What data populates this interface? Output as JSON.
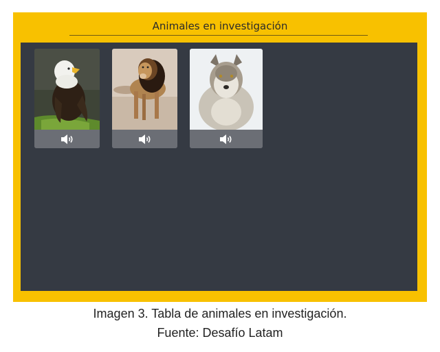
{
  "panel": {
    "title": "Animales en investigación"
  },
  "animals": [
    {
      "name": "eagle",
      "icon": "speaker-icon"
    },
    {
      "name": "lion",
      "icon": "speaker-icon"
    },
    {
      "name": "wolf",
      "icon": "speaker-icon"
    }
  ],
  "caption": {
    "line1": "Imagen 3. Tabla de animales en investigación.",
    "line2": "Fuente: Desafío Latam"
  },
  "colors": {
    "frame": "#f8c100",
    "panel": "#353a43",
    "sound_bar": "#6b6e75"
  }
}
